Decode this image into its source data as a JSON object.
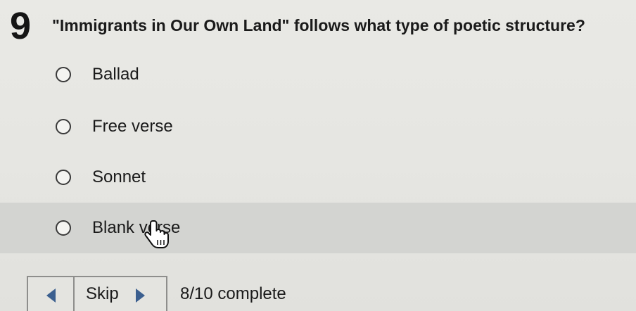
{
  "question": {
    "number": "9",
    "text": "\"Immigrants in Our Own Land\" follows what type of poetic structure?"
  },
  "options": [
    {
      "label": "Ballad",
      "selected": false
    },
    {
      "label": "Free verse",
      "selected": false
    },
    {
      "label": "Sonnet",
      "selected": false
    },
    {
      "label": "Blank verse",
      "selected": true
    }
  ],
  "navigation": {
    "skip_label": "Skip",
    "progress_text": "8/10 complete",
    "prev_icon": "triangle-left-icon",
    "next_icon": "triangle-right-icon"
  },
  "colors": {
    "accent": "#3b5f8f",
    "selected_row": "#d3d4d1"
  }
}
